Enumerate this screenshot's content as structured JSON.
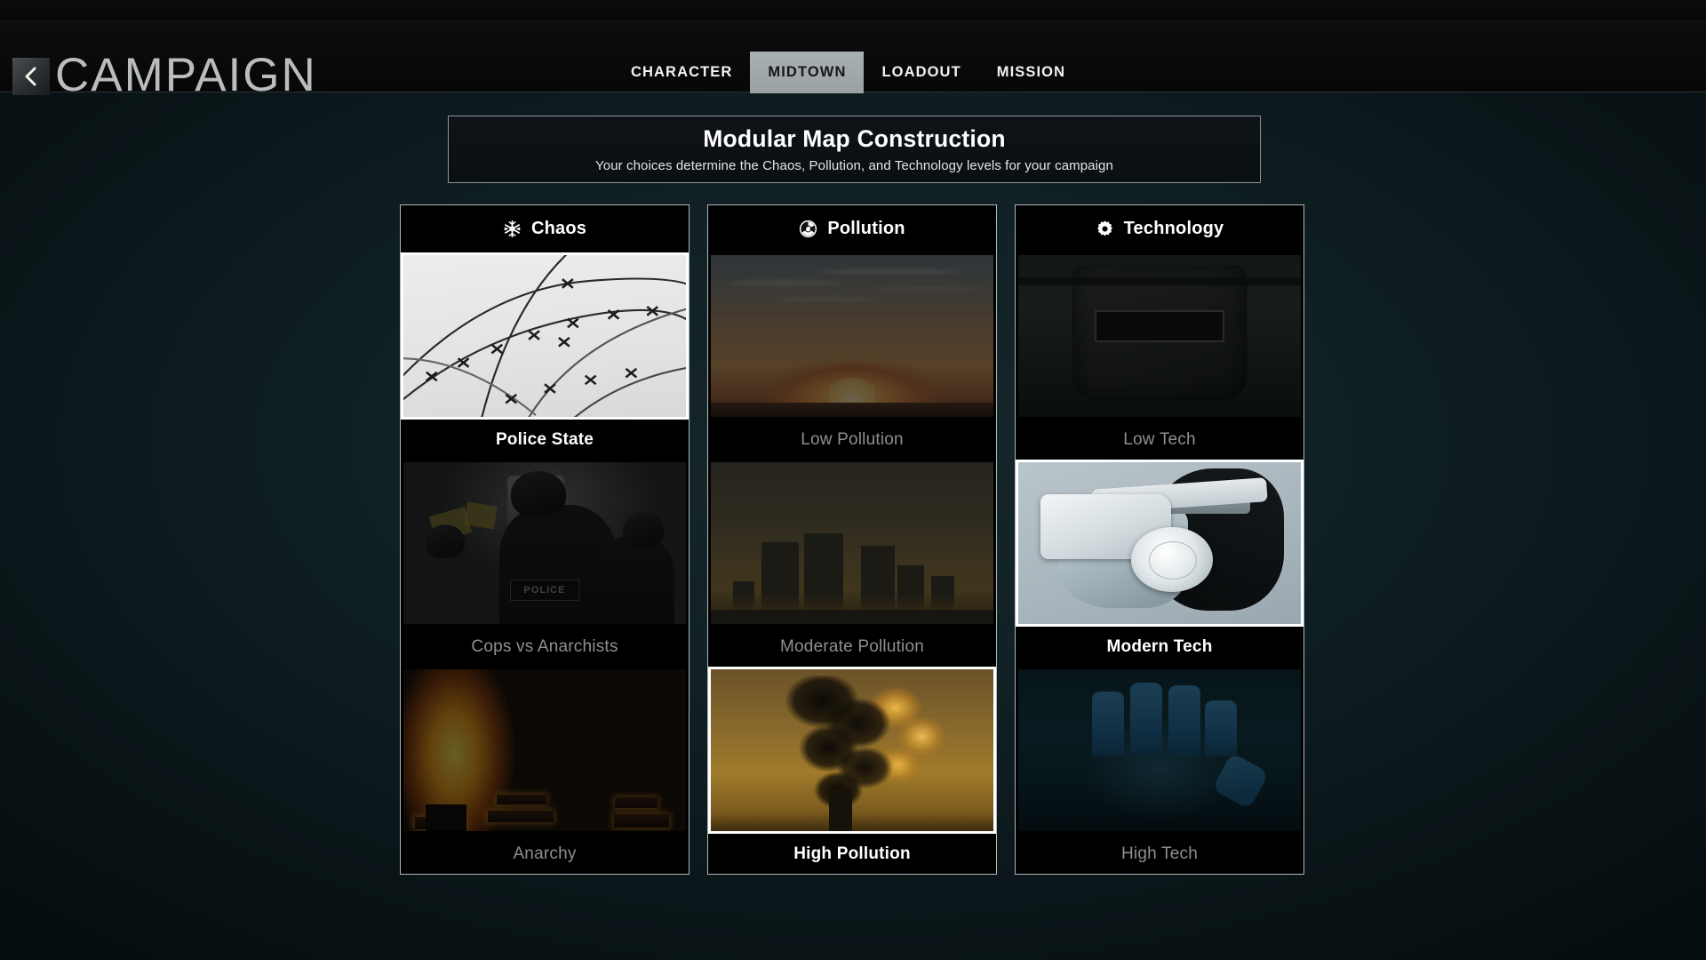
{
  "window": {
    "title": "CAMPAIGN"
  },
  "topbar": {
    "back_label": "Back",
    "title": "CAMPAIGN",
    "tabs": [
      {
        "label": "CHARACTER",
        "active": false
      },
      {
        "label": "MIDTOWN",
        "active": true
      },
      {
        "label": "LOADOUT",
        "active": false
      },
      {
        "label": "MISSION",
        "active": false
      }
    ]
  },
  "header": {
    "title": "Modular Map Construction",
    "subtitle": "Your choices determine the Chaos, Pollution, and Technology levels for your campaign"
  },
  "columns": [
    {
      "name": "chaos",
      "title": "Chaos",
      "icon": "asterisk-burst-icon",
      "options": [
        {
          "label": "Police State",
          "selected": true,
          "art": "barbed-wire-photo"
        },
        {
          "label": "Cops vs Anarchists",
          "selected": false,
          "art": "riot-police-photo"
        },
        {
          "label": "Anarchy",
          "selected": false,
          "art": "burning-building-photo"
        }
      ]
    },
    {
      "name": "pollution",
      "title": "Pollution",
      "icon": "radioactive-icon",
      "options": [
        {
          "label": "Low Pollution",
          "selected": false,
          "art": "clear-sunset-photo"
        },
        {
          "label": "Moderate Pollution",
          "selected": false,
          "art": "hazy-skyline-photo"
        },
        {
          "label": "High Pollution",
          "selected": true,
          "art": "smokestack-plume-photo"
        }
      ]
    },
    {
      "name": "technology",
      "title": "Technology",
      "icon": "gear-icon",
      "options": [
        {
          "label": "Low Tech",
          "selected": false,
          "art": "welding-mask-photo"
        },
        {
          "label": "Modern Tech",
          "selected": true,
          "art": "vr-headset-photo"
        },
        {
          "label": "High Tech",
          "selected": false,
          "art": "scanned-hand-photo"
        }
      ]
    }
  ],
  "theme": {
    "background": "#0a1518",
    "panel_border": "#b0b6b8",
    "selected_border": "#ffffff",
    "selected_text": "#ffffff",
    "unselected_text": "#8b9092",
    "active_tab_bg": "#a9b0b2",
    "title_color": "#b9bdbf"
  }
}
